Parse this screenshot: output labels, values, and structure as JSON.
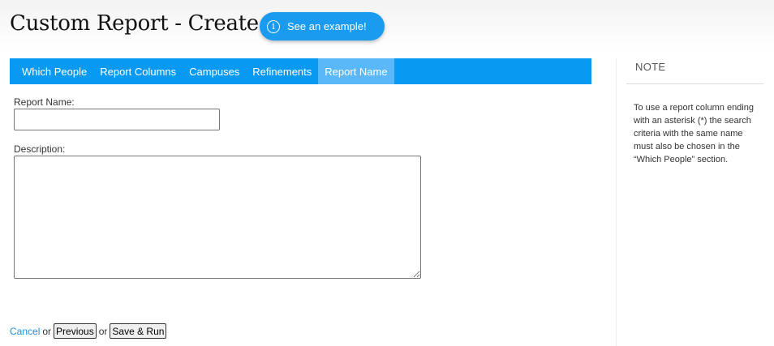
{
  "header": {
    "title": "Custom Report - Create",
    "example_button": {
      "icon": "info-icon",
      "icon_glyph": "i",
      "label": "See an example!"
    }
  },
  "tabs": [
    {
      "label": "Which People",
      "active": false
    },
    {
      "label": "Report Columns",
      "active": false
    },
    {
      "label": "Campuses",
      "active": false
    },
    {
      "label": "Refinements",
      "active": false
    },
    {
      "label": "Report Name",
      "active": true
    }
  ],
  "form": {
    "report_name_label": "Report Name:",
    "report_name_value": "",
    "description_label": "Description:",
    "description_value": ""
  },
  "actions": {
    "cancel_label": "Cancel",
    "or_text": "or",
    "previous_label": "Previous",
    "save_run_label": "Save & Run"
  },
  "note": {
    "title": "NOTE",
    "text": "To use a report column ending with an asterisk (*) the search criteria with the same name must also be chosen in the “Which People” section."
  },
  "colors": {
    "accent": "#0899f3",
    "active_tab": "#5ab8f8",
    "link": "#1a8fe0"
  }
}
